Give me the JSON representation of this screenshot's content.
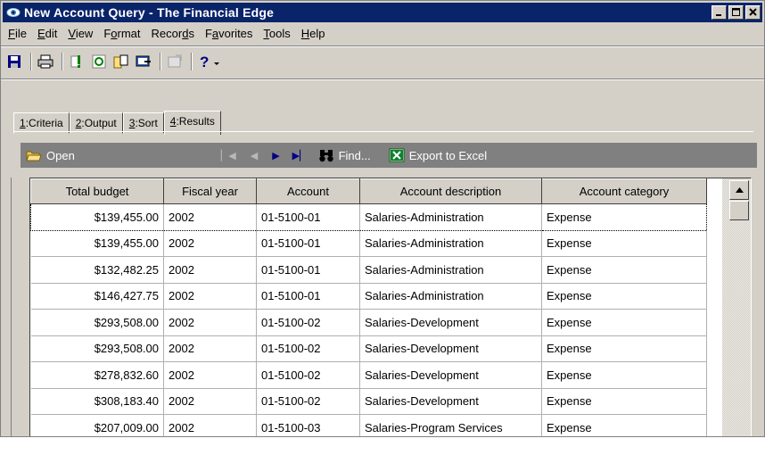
{
  "window": {
    "title": "New Account Query - The Financial Edge",
    "controls": [
      "minimize",
      "maximize",
      "close"
    ]
  },
  "menu": [
    {
      "pre": "",
      "acc": "F",
      "post": "ile"
    },
    {
      "pre": "",
      "acc": "E",
      "post": "dit"
    },
    {
      "pre": "",
      "acc": "V",
      "post": "iew"
    },
    {
      "pre": "F",
      "acc": "o",
      "post": "rmat"
    },
    {
      "pre": "Recor",
      "acc": "d",
      "post": "s"
    },
    {
      "pre": "F",
      "acc": "a",
      "post": "vorites"
    },
    {
      "pre": "",
      "acc": "T",
      "post": "ools"
    },
    {
      "pre": "",
      "acc": "H",
      "post": "elp"
    }
  ],
  "toolbar": {
    "icons": [
      "save-icon",
      "print-icon",
      "run-query-icon",
      "refresh-icon",
      "copy-icon",
      "export-icon",
      "properties-icon",
      "help-icon"
    ]
  },
  "tabs": [
    {
      "num": "1",
      "label": ":Criteria"
    },
    {
      "num": "2",
      "label": ":Output"
    },
    {
      "num": "3",
      "label": ":Sort"
    },
    {
      "num": "4",
      "label": ":Results"
    }
  ],
  "results_toolbar": {
    "open_label": "Open",
    "find_label": "Find...",
    "export_label": "Export to Excel"
  },
  "grid": {
    "columns": [
      "Total budget",
      "Fiscal year",
      "Account",
      "Account description",
      "Account category"
    ],
    "rows": [
      [
        "$139,455.00",
        "2002",
        "01-5100-01",
        "Salaries-Administration",
        "Expense"
      ],
      [
        "$139,455.00",
        "2002",
        "01-5100-01",
        "Salaries-Administration",
        "Expense"
      ],
      [
        "$132,482.25",
        "2002",
        "01-5100-01",
        "Salaries-Administration",
        "Expense"
      ],
      [
        "$146,427.75",
        "2002",
        "01-5100-01",
        "Salaries-Administration",
        "Expense"
      ],
      [
        "$293,508.00",
        "2002",
        "01-5100-02",
        "Salaries-Development",
        "Expense"
      ],
      [
        "$293,508.00",
        "2002",
        "01-5100-02",
        "Salaries-Development",
        "Expense"
      ],
      [
        "$278,832.60",
        "2002",
        "01-5100-02",
        "Salaries-Development",
        "Expense"
      ],
      [
        "$308,183.40",
        "2002",
        "01-5100-02",
        "Salaries-Development",
        "Expense"
      ],
      [
        "$207,009.00",
        "2002",
        "01-5100-03",
        "Salaries-Program Services",
        "Expense"
      ],
      [
        "",
        "",
        "",
        "",
        ""
      ]
    ]
  }
}
